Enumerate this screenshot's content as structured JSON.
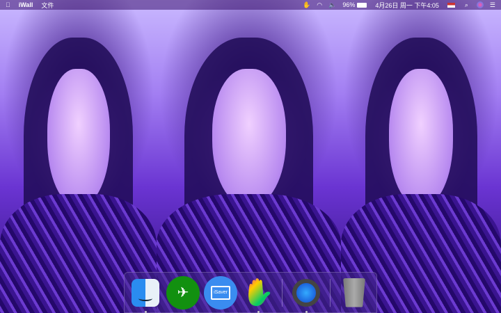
{
  "menubar": {
    "app_name": "iWall",
    "menus": [
      "文件"
    ],
    "battery": "96%",
    "datetime": "4月26日 周一 下午4:05"
  },
  "dock": {
    "apps": [
      {
        "name": "Finder",
        "running": true
      },
      {
        "name": "Airplane App",
        "running": false
      },
      {
        "name": "iSaver",
        "label": "iSaver",
        "running": false
      },
      {
        "name": "Hand Paint App",
        "running": true
      },
      {
        "name": "QuickTime Player",
        "running": true
      },
      {
        "name": "Trash",
        "running": false
      }
    ]
  },
  "colors": {
    "accent": "#8a4cf0",
    "menubar": "#3c146e"
  }
}
